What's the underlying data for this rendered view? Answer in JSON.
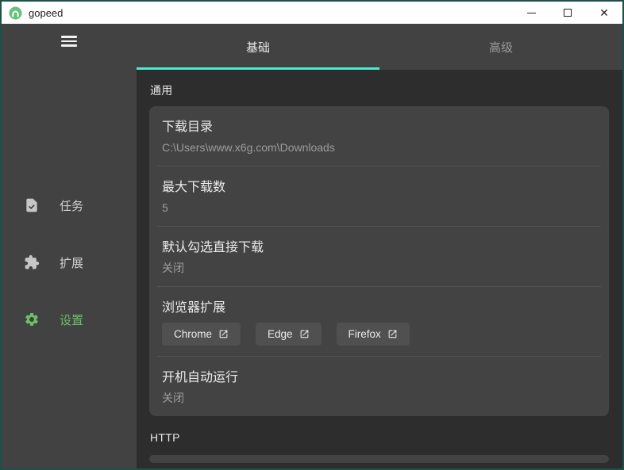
{
  "window": {
    "title": "gopeed",
    "controls": {
      "minimize": "minimize",
      "maximize": "maximize",
      "close": "✕"
    }
  },
  "colors": {
    "accent_teal": "#50ead0",
    "accent_green": "#6abf69",
    "window_border": "#1d5148",
    "titlebar_bg": "#ffffff",
    "sidebar_bg": "#424242",
    "content_bg": "#2d2d2d",
    "card_bg": "#434343"
  },
  "icons": {
    "logo": "gopeed-logo (green circle, white arch)",
    "menu": "hamburger-icon",
    "tasks": "task-document-check-icon",
    "extensions": "puzzle-piece-icon",
    "settings": "gear-icon",
    "external": "open-in-new-icon"
  },
  "sidebar": {
    "items": [
      {
        "label": "任务"
      },
      {
        "label": "扩展"
      },
      {
        "label": "设置"
      }
    ]
  },
  "tabs": [
    {
      "label": "基础",
      "active": true
    },
    {
      "label": "高级",
      "active": false
    }
  ],
  "general": {
    "header": "通用",
    "rows": [
      {
        "title": "下载目录",
        "value": "C:\\Users\\www.x6g.com\\Downloads"
      },
      {
        "title": "最大下载数",
        "value": "5"
      },
      {
        "title": "默认勾选直接下载",
        "value": "关闭"
      },
      {
        "title": "浏览器扩展",
        "buttons": [
          {
            "label": "Chrome"
          },
          {
            "label": "Edge"
          },
          {
            "label": "Firefox"
          }
        ]
      },
      {
        "title": "开机自动运行",
        "value": "关闭"
      }
    ]
  },
  "http": {
    "header": "HTTP"
  }
}
